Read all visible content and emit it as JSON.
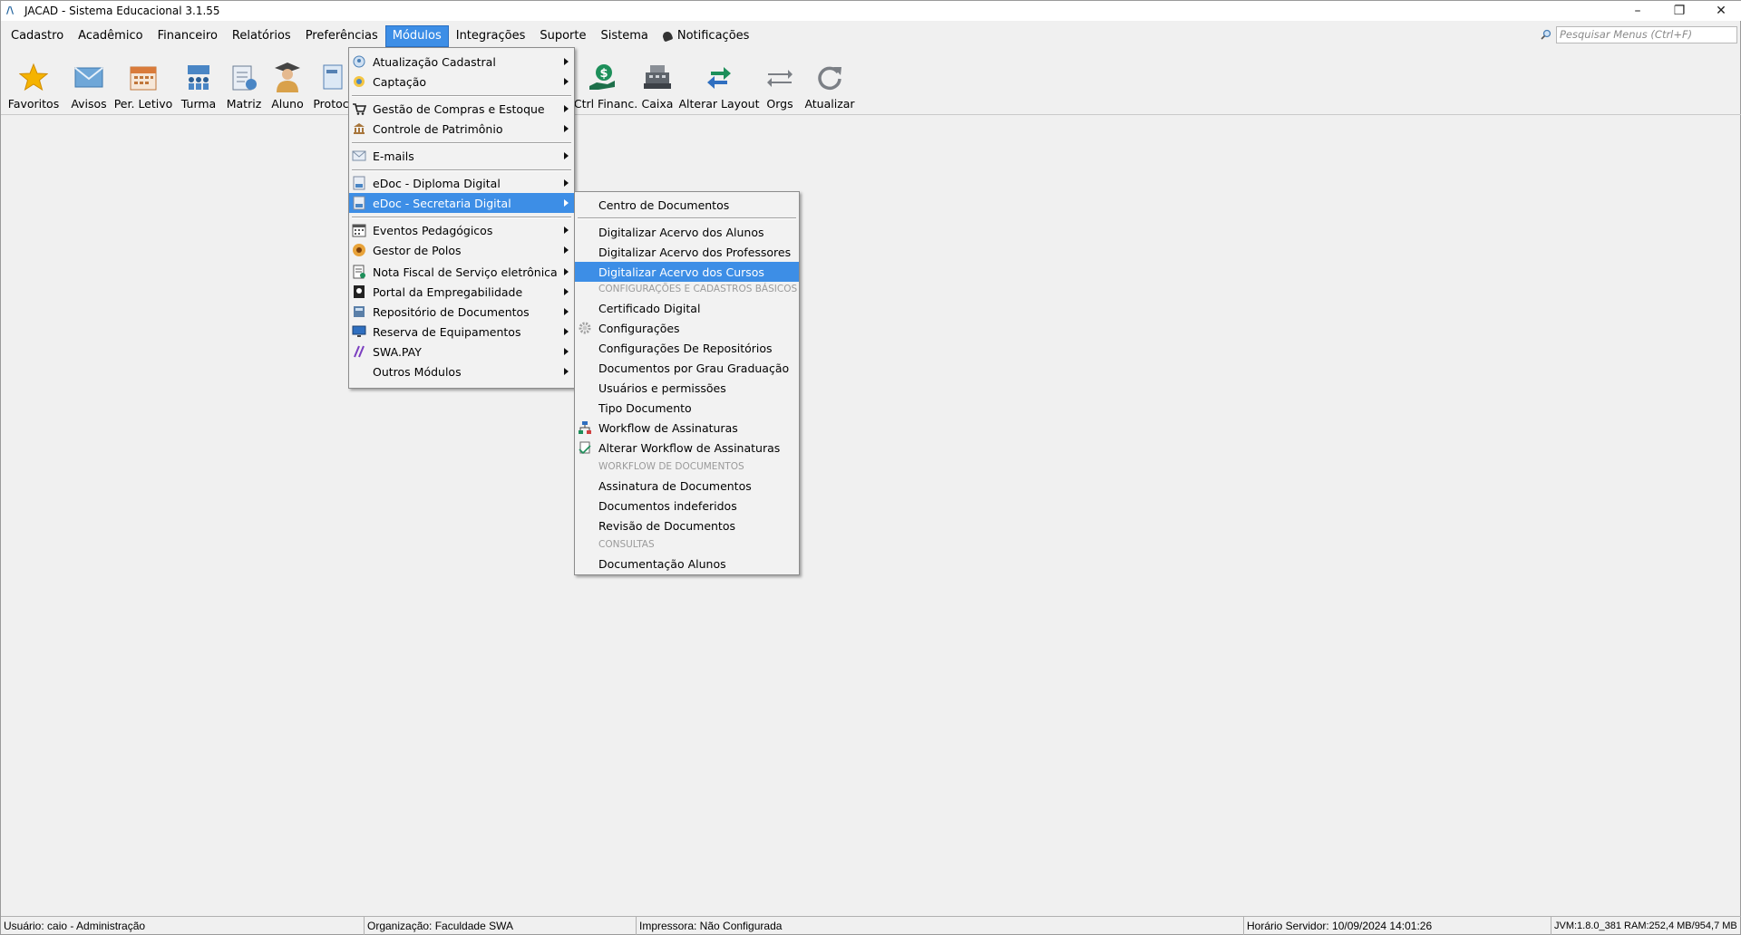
{
  "window": {
    "title": "JACAD - Sistema Educacional 3.1.55"
  },
  "menubar": {
    "items": [
      "Cadastro",
      "Acadêmico",
      "Financeiro",
      "Relatórios",
      "Preferências",
      "Módulos",
      "Integrações",
      "Suporte",
      "Sistema"
    ],
    "notifications": "Notificações",
    "search_placeholder": "Pesquisar Menus (Ctrl+F)"
  },
  "toolbar": {
    "buttons": [
      "Favoritos",
      "Avisos",
      "Per. Letivo",
      "Turma",
      "Matriz",
      "Aluno",
      "Protoc",
      "Ctrl Financ.",
      "Caixa",
      "Alterar Layout",
      "Orgs",
      "Atualizar"
    ]
  },
  "modulos_menu": {
    "items": [
      "Atualização Cadastral",
      "Captação",
      "Gestão de Compras e Estoque",
      "Controle de Patrimônio",
      "E-mails",
      "eDoc - Diploma Digital",
      "eDoc - Secretaria Digital",
      "Eventos Pedagógicos",
      "Gestor de Polos",
      "Nota Fiscal de Serviço eletrônica",
      "Portal da Empregabilidade",
      "Repositório de Documentos",
      "Reserva de Equipamentos",
      "SWA.PAY",
      "Outros Módulos"
    ],
    "highlighted": "eDoc - Secretaria Digital"
  },
  "submenu": {
    "items": [
      "Centro de Documentos",
      "Digitalizar Acervo dos Alunos",
      "Digitalizar Acervo dos Professores",
      "Digitalizar Acervo dos Cursos",
      "Certificado Digital",
      "Configurações",
      "Configurações De Repositórios",
      "Documentos por Grau Graduação",
      "Usuários e permissões",
      "Tipo Documento",
      "Workflow de Assinaturas",
      "Alterar Workflow de Assinaturas",
      "Assinatura de Documentos",
      "Documentos indeferidos",
      "Revisão de Documentos",
      "Documentação Alunos"
    ],
    "headers": [
      "CONFIGURAÇÕES E CADASTROS BÁSICOS",
      "WORKFLOW DE DOCUMENTOS",
      "CONSULTAS"
    ],
    "highlighted": "Digitalizar Acervo dos Cursos"
  },
  "statusbar": {
    "user": "Usuário: caio - Administração",
    "org": "Organização: Faculdade SWA",
    "printer": "Impressora: Não Configurada",
    "server_time": "Horário Servidor: 10/09/2024 14:01:26",
    "jvm": "JVM:1.8.0_381  RAM:252,4 MB/954,7 MB"
  },
  "colors": {
    "highlight": "#3d8ee6",
    "background": "#f0f0f0"
  }
}
